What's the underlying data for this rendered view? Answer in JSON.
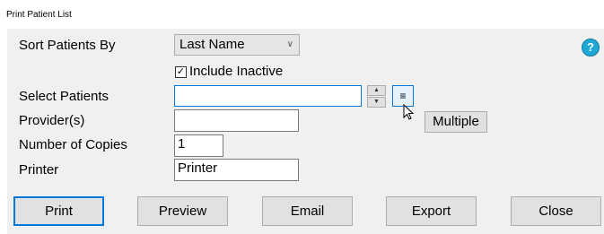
{
  "window": {
    "title": "Print Patient List"
  },
  "form": {
    "sort_label": "Sort Patients By",
    "sort_value": "Last Name",
    "include_inactive_label": "Include Inactive",
    "include_inactive_checked": true,
    "select_patients_label": "Select Patients",
    "select_patients_value": "",
    "providers_label": "Provider(s)",
    "providers_value": "",
    "copies_label": "Number of Copies",
    "copies_value": "1",
    "printer_label": "Printer",
    "printer_value": "Printer",
    "multiple_label": "Multiple",
    "help_label": "?"
  },
  "buttons": {
    "print": "Print",
    "preview": "Preview",
    "email": "Email",
    "export": "Export",
    "close": "Close"
  },
  "icons": {
    "dropdown": "chevron-down-icon",
    "spin_up": "spin-up-icon",
    "spin_down": "spin-down-icon",
    "list": "list-icon",
    "help": "help-icon",
    "cursor": "mouse-pointer-icon"
  },
  "colors": {
    "help": "#1fa7d6",
    "focus": "#0078d7",
    "panel": "#f0f0f0"
  }
}
